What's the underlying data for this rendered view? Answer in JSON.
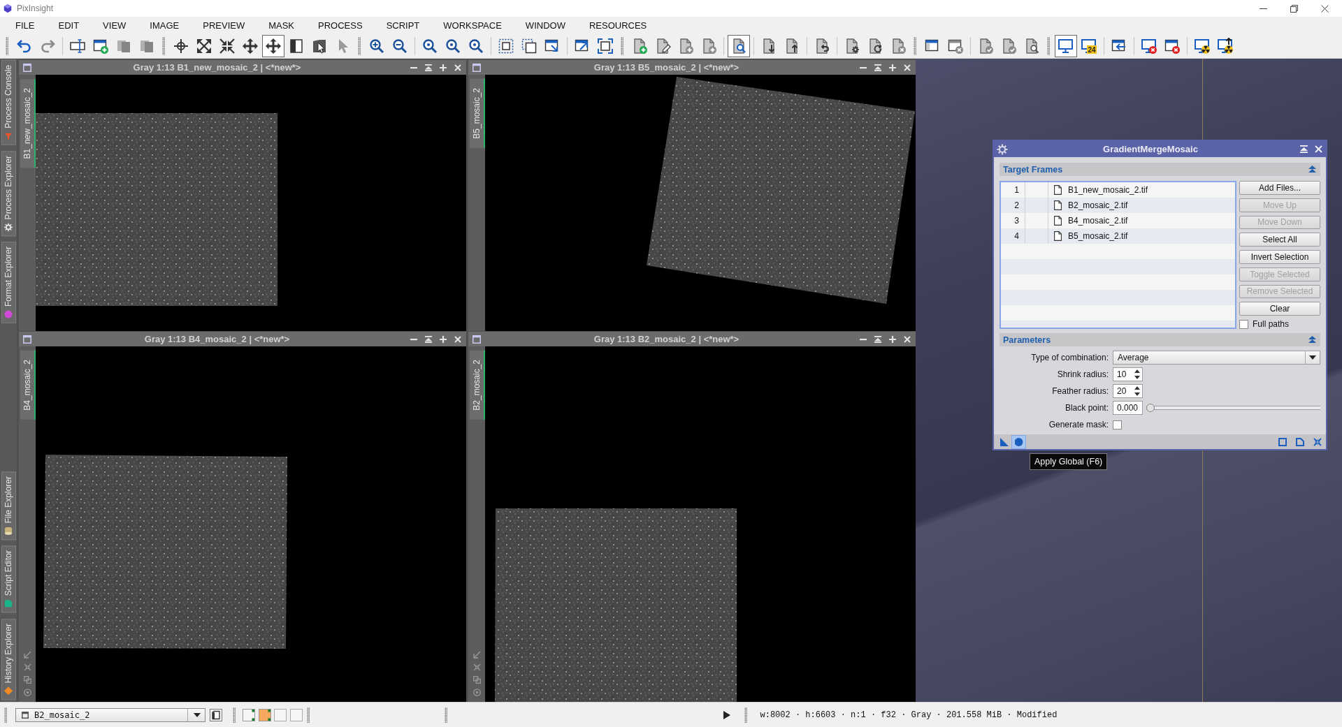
{
  "app_title": "PixInsight",
  "menu": [
    "FILE",
    "EDIT",
    "VIEW",
    "IMAGE",
    "PREVIEW",
    "MASK",
    "PROCESS",
    "SCRIPT",
    "WORKSPACE",
    "WINDOW",
    "RESOURCES"
  ],
  "toolbar": [
    {
      "kind": "grip",
      "buttons": [
        {
          "kind": "undo",
          "selected": false
        },
        {
          "kind": "redo",
          "selected": false
        }
      ]
    },
    {
      "kind": "separator",
      "buttons": [
        {
          "kind": "field",
          "selected": false
        },
        {
          "kind": "newwin",
          "selected": false
        },
        {
          "kind": "pages",
          "selected": false
        },
        {
          "kind": "pages",
          "selected": false
        }
      ]
    },
    {
      "kind": "grip",
      "buttons": [
        {
          "kind": "crosshair",
          "selected": false
        },
        {
          "kind": "expand",
          "selected": false
        },
        {
          "kind": "shrink",
          "selected": false
        },
        {
          "kind": "move",
          "selected": false
        },
        {
          "kind": "move",
          "selected": true
        },
        {
          "kind": "halfsquare",
          "selected": false
        },
        {
          "kind": "pointerwin",
          "selected": false
        },
        {
          "kind": "pointer",
          "selected": false
        }
      ]
    },
    {
      "kind": "grip",
      "buttons": [
        {
          "kind": "zoomin",
          "selected": false
        },
        {
          "kind": "zoomout",
          "selected": false
        }
      ]
    },
    {
      "kind": "separator",
      "buttons": [
        {
          "kind": "zoom",
          "selected": false
        },
        {
          "kind": "zoom",
          "selected": false
        },
        {
          "kind": "zoom",
          "selected": false
        }
      ]
    },
    {
      "kind": "separator",
      "buttons": [
        {
          "kind": "dashframe",
          "selected": false
        },
        {
          "kind": "dashframes",
          "selected": false
        },
        {
          "kind": "winarrow",
          "selected": false
        }
      ]
    },
    {
      "kind": "separator",
      "buttons": [
        {
          "kind": "winout",
          "selected": false
        },
        {
          "kind": "fitframe",
          "selected": false
        }
      ]
    },
    {
      "kind": "grip",
      "buttons": [
        {
          "kind": "docnew",
          "selected": false
        },
        {
          "kind": "docpen",
          "selected": false
        },
        {
          "kind": "docplus",
          "selected": false
        },
        {
          "kind": "docplus",
          "selected": false
        }
      ]
    },
    {
      "kind": "separator",
      "buttons": [
        {
          "kind": "preview",
          "selected": true
        }
      ]
    },
    {
      "kind": "separator",
      "buttons": [
        {
          "kind": "docdown",
          "selected": false
        },
        {
          "kind": "docup",
          "selected": false
        }
      ]
    },
    {
      "kind": "separator",
      "buttons": [
        {
          "kind": "docundo",
          "selected": false
        }
      ]
    },
    {
      "kind": "separator",
      "buttons": [
        {
          "kind": "docgear",
          "selected": false
        },
        {
          "kind": "docrefresh",
          "selected": false
        },
        {
          "kind": "docx",
          "selected": false
        }
      ]
    },
    {
      "kind": "grip",
      "buttons": [
        {
          "kind": "winbar",
          "selected": false
        },
        {
          "kind": "winx",
          "selected": false
        }
      ]
    },
    {
      "kind": "separator",
      "buttons": [
        {
          "kind": "doccheck",
          "selected": false
        },
        {
          "kind": "doccheck",
          "selected": false
        },
        {
          "kind": "docsearch",
          "selected": false
        }
      ]
    },
    {
      "kind": "grip",
      "buttons": [
        {
          "kind": "monitor",
          "selected": true
        },
        {
          "kind": "monitor",
          "selected": false,
          "badge": "24"
        }
      ]
    },
    {
      "kind": "separator",
      "buttons": [
        {
          "kind": "winin",
          "selected": false
        }
      ]
    },
    {
      "kind": "separator",
      "buttons": [
        {
          "kind": "monx",
          "selected": false
        },
        {
          "kind": "winredx",
          "selected": false
        }
      ]
    },
    {
      "kind": "separator",
      "buttons": [
        {
          "kind": "monhazard",
          "selected": false
        },
        {
          "kind": "monhazardup",
          "selected": false
        }
      ]
    }
  ],
  "left_dock": {
    "top_tabs": [
      {
        "label": "Process Console",
        "kind": "console"
      },
      {
        "label": "Process Explorer",
        "kind": "explorer"
      },
      {
        "label": "Format Explorer",
        "kind": "format"
      }
    ],
    "bottom_tabs": [
      {
        "label": "File Explorer",
        "kind": "files"
      },
      {
        "label": "Script Editor",
        "kind": "script"
      },
      {
        "label": "History Explorer",
        "kind": "history"
      }
    ]
  },
  "image_windows": [
    {
      "title": "Gray 1:13 B1_new_mosaic_2 | <*new*>",
      "tab": "B1_new_mosaic_2",
      "view_tools": false
    },
    {
      "title": "Gray 1:13 B5_mosaic_2 | <*new*>",
      "tab": "B5_mosaic_2",
      "view_tools": false
    },
    {
      "title": "Gray 1:13 B4_mosaic_2 | <*new*>",
      "tab": "B4_mosaic_2",
      "view_tools": true
    },
    {
      "title": "Gray 1:13 B2_mosaic_2 | <*new*>",
      "tab": "B2_mosaic_2",
      "view_tools": true
    }
  ],
  "process_dialog": {
    "title": "GradientMergeMosaic",
    "target_frames": {
      "title": "Target Frames",
      "expanded": true,
      "files": [
        {
          "number": "1",
          "name": "B1_new_mosaic_2.tif",
          "selected": false
        },
        {
          "number": "2",
          "name": "B2_mosaic_2.tif",
          "selected": false
        },
        {
          "number": "3",
          "name": "B4_mosaic_2.tif",
          "selected": false
        },
        {
          "number": "4",
          "name": "B5_mosaic_2.tif",
          "selected": false
        }
      ],
      "buttons": [
        {
          "label": "Add Files...",
          "disabled": false
        },
        {
          "label": "Move Up",
          "disabled": true
        },
        {
          "label": "Move Down",
          "disabled": true
        },
        {
          "label": "Select All",
          "disabled": false
        },
        {
          "label": "Invert Selection",
          "disabled": false
        },
        {
          "label": "Toggle Selected",
          "disabled": true
        },
        {
          "label": "Remove Selected",
          "disabled": true
        },
        {
          "label": "Clear",
          "disabled": false
        }
      ],
      "full_paths": {
        "label": "Full paths",
        "checked": false
      }
    },
    "parameters": {
      "title": "Parameters",
      "expanded": true,
      "rows": [
        {
          "kind": "combo",
          "label": "Type of combination:",
          "value": "Average"
        },
        {
          "kind": "spin",
          "label": "Shrink radius:",
          "value": "10"
        },
        {
          "kind": "spin",
          "label": "Feather radius:",
          "value": "20"
        },
        {
          "kind": "slider",
          "label": "Black point:",
          "value": "0.000",
          "level": 0
        },
        {
          "kind": "checkbox",
          "label": "Generate mask:",
          "checked": false
        }
      ]
    },
    "footer_left": [
      {
        "kind": "instance",
        "hovered": false
      },
      {
        "kind": "apply",
        "hovered": true
      }
    ],
    "footer_right": [
      {
        "kind": "square",
        "hovered": false
      },
      {
        "kind": "document",
        "hovered": false
      },
      {
        "kind": "compress",
        "hovered": false
      }
    ],
    "tooltip": "Apply Global (F6)"
  },
  "status_bar": {
    "view": "B2_mosaic_2",
    "display_buttons": [
      {
        "kind": "corners"
      },
      {
        "kind": "fill"
      },
      {
        "kind": "blank"
      },
      {
        "kind": "blank"
      }
    ],
    "info": "w:8002 · h:6603 · n:1 · f32 · Gray · 201.558 MiB · Modified"
  }
}
